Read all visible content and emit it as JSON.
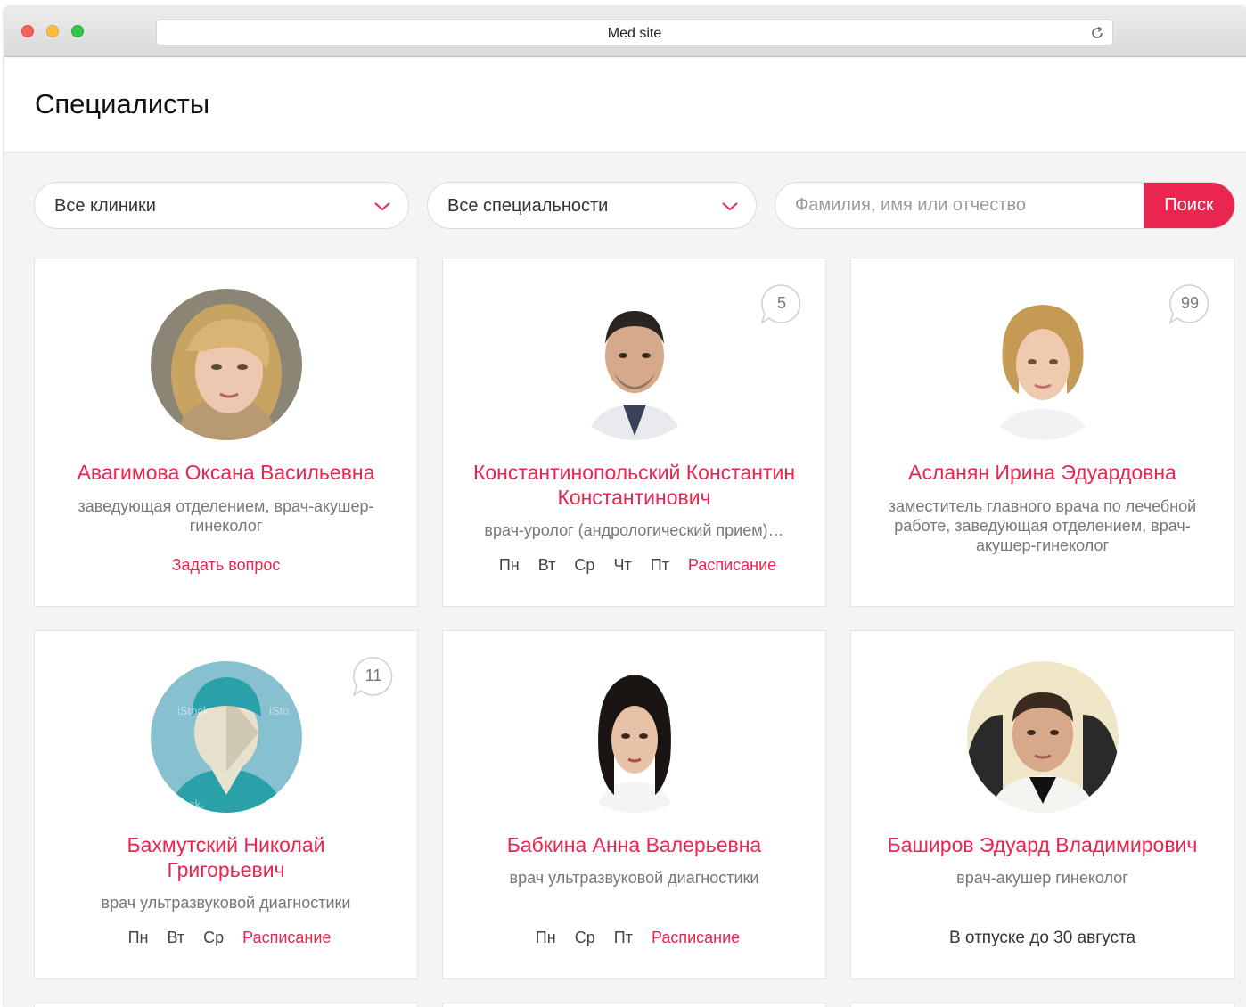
{
  "browser": {
    "title": "Med site"
  },
  "page": {
    "title": "Специалисты"
  },
  "filters": {
    "clinic": "Все клиники",
    "specialty": "Все специальности",
    "search_placeholder": "Фамилия, имя или отчество",
    "search_button": "Поиск"
  },
  "cards": [
    {
      "name": "Авагимова Оксана Васильевна",
      "role": "заведующая отделением, врач-акушер-гинеколог",
      "link": "Задать вопрос"
    },
    {
      "name": "Константинопольский Константин Константинович",
      "role": "врач-уролог (андрологический прием)…",
      "count": "5",
      "days": [
        "Пн",
        "Вт",
        "Ср",
        "Чт",
        "Пт"
      ],
      "link": "Расписание"
    },
    {
      "name": "Асланян Ирина Эдуардовна",
      "role": "заместитель главного врача по лечебной работе, заведующая отделением, врач-акушер-гинеколог",
      "count": "99"
    },
    {
      "name": "Бахмутский Николай Григорьевич",
      "role": "врач ультразвуковой диагностики",
      "count": "11",
      "days": [
        "Пн",
        "Вт",
        "Ср"
      ],
      "link": "Расписание"
    },
    {
      "name": "Бабкина Анна Валерьевна",
      "role": "врач ультразвуковой диагностики",
      "days": [
        "Пн",
        "Ср",
        "Пт"
      ],
      "link": "Расписание"
    },
    {
      "name": "Баширов Эдуард Владимирович",
      "role": "врач-акушер гинеколог",
      "vacation": "В отпуске до 30 августа"
    }
  ]
}
